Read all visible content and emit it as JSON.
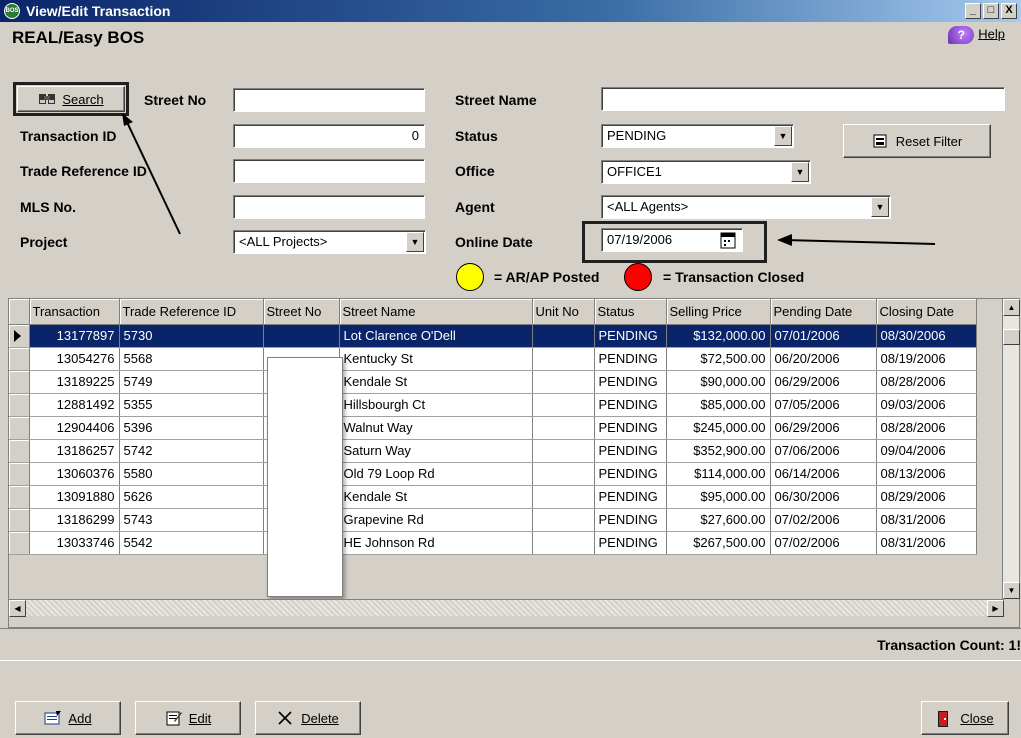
{
  "window": {
    "title": "View/Edit Transaction",
    "app_icon_text": "BOS",
    "minimize": "_",
    "maximize": "□",
    "close": "X"
  },
  "header": {
    "app_name": "REAL/Easy BOS",
    "help_label": "Help",
    "help_icon_text": "?"
  },
  "filters": {
    "search_button": "Search",
    "street_no_label": "Street No",
    "street_no_value": "",
    "street_name_label": "Street Name",
    "street_name_value": "",
    "transaction_id_label": "Transaction ID",
    "transaction_id_value": "0",
    "status_label": "Status",
    "status_value": "PENDING",
    "reset_filter_button": "Reset Filter",
    "trade_ref_label": "Trade Reference ID",
    "trade_ref_value": "",
    "office_label": "Office",
    "office_value": "OFFICE1",
    "mls_label": "MLS No.",
    "mls_value": "",
    "agent_label": "Agent",
    "agent_value": "<ALL Agents>",
    "project_label": "Project",
    "project_value": "<ALL Projects>",
    "online_date_label": "Online Date",
    "online_date_value": "07/19/2006"
  },
  "legend": {
    "posted_label": "= AR/AP Posted",
    "posted_color": "#ffff00",
    "closed_label": "= Transaction Closed",
    "closed_color": "#ff0000"
  },
  "grid": {
    "columns": [
      "Transaction",
      "Trade Reference ID",
      "Street No",
      "Street Name",
      "Unit No",
      "Status",
      "Selling Price",
      "Pending Date",
      "Closing Date"
    ],
    "rows": [
      [
        "13177897",
        "5730",
        "",
        "Lot Clarence O'Dell",
        "",
        "PENDING",
        "$132,000.00",
        "07/01/2006",
        "08/30/2006"
      ],
      [
        "13054276",
        "5568",
        "",
        "Kentucky St",
        "",
        "PENDING",
        "$72,500.00",
        "06/20/2006",
        "08/19/2006"
      ],
      [
        "13189225",
        "5749",
        "",
        "Kendale St",
        "",
        "PENDING",
        "$90,000.00",
        "06/29/2006",
        "08/28/2006"
      ],
      [
        "12881492",
        "5355",
        "",
        "Hillsbourgh Ct",
        "",
        "PENDING",
        "$85,000.00",
        "07/05/2006",
        "09/03/2006"
      ],
      [
        "12904406",
        "5396",
        "",
        "Walnut Way",
        "",
        "PENDING",
        "$245,000.00",
        "06/29/2006",
        "08/28/2006"
      ],
      [
        "13186257",
        "5742",
        "",
        "Saturn Way",
        "",
        "PENDING",
        "$352,900.00",
        "07/06/2006",
        "09/04/2006"
      ],
      [
        "13060376",
        "5580",
        "",
        "Old 79 Loop Rd",
        "",
        "PENDING",
        "$114,000.00",
        "06/14/2006",
        "08/13/2006"
      ],
      [
        "13091880",
        "5626",
        "",
        "Kendale St",
        "",
        "PENDING",
        "$95,000.00",
        "06/30/2006",
        "08/29/2006"
      ],
      [
        "13186299",
        "5743",
        "",
        "Grapevine Rd",
        "",
        "PENDING",
        "$27,600.00",
        "07/02/2006",
        "08/31/2006"
      ],
      [
        "13033746",
        "5542",
        "",
        "HE Johnson Rd",
        "",
        "PENDING",
        "$267,500.00",
        "07/02/2006",
        "08/31/2006"
      ]
    ]
  },
  "status": {
    "transaction_count": "Transaction Count: 1!"
  },
  "actions": {
    "add": "Add",
    "edit": "Edit",
    "delete": "Delete",
    "close": "Close"
  }
}
